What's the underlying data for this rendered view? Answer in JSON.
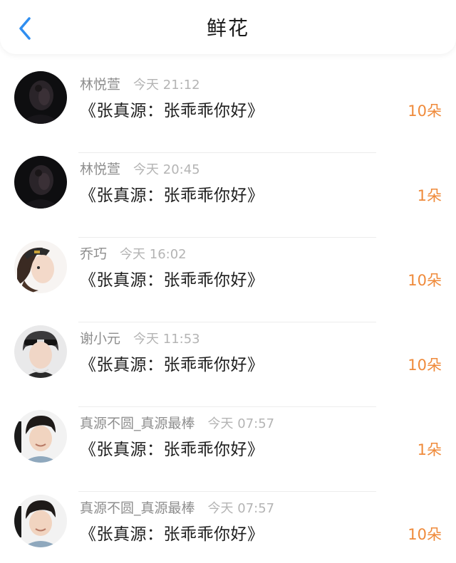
{
  "header": {
    "title": "鲜花",
    "back_icon": "chevron-left-icon"
  },
  "colors": {
    "accent_blue": "#2f8ef0",
    "count_orange": "#ef8a3a"
  },
  "items": [
    {
      "name": "林悦萱",
      "time": "今天 21:12",
      "message": "《张真源：张乖乖你好》",
      "count": "10朵",
      "avatar": "dark-portrait-avatar"
    },
    {
      "name": "林悦萱",
      "time": "今天 20:45",
      "message": "《张真源：张乖乖你好》",
      "count": "1朵",
      "avatar": "dark-portrait-avatar"
    },
    {
      "name": "乔巧",
      "time": "今天 16:02",
      "message": "《张真源：张乖乖你好》",
      "count": "10朵",
      "avatar": "girl-with-cap-avatar"
    },
    {
      "name": "谢小元",
      "time": "今天 11:53",
      "message": "《张真源：张乖乖你好》",
      "count": "10朵",
      "avatar": "boy-with-headband-avatar"
    },
    {
      "name": "真源不圆_真源最棒",
      "time": "今天 07:57",
      "message": "《张真源：张乖乖你好》",
      "count": "1朵",
      "avatar": "boy-portrait-avatar"
    },
    {
      "name": "真源不圆_真源最棒",
      "time": "今天 07:57",
      "message": "《张真源：张乖乖你好》",
      "count": "10朵",
      "avatar": "boy-portrait-avatar"
    }
  ]
}
